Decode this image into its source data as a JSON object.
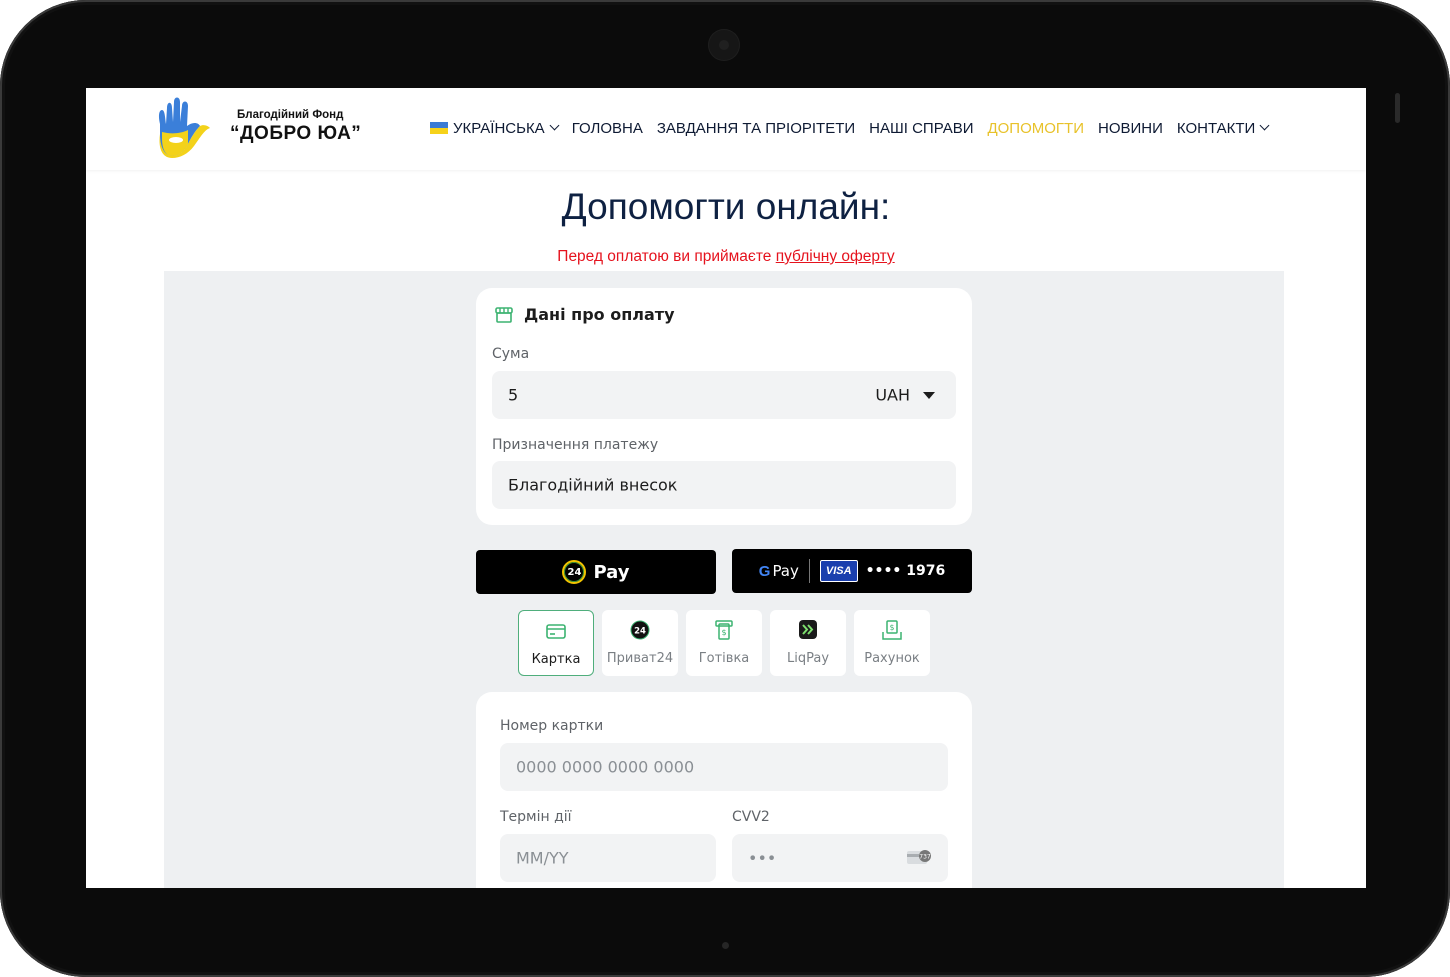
{
  "header": {
    "logo_line1": "Благодійний Фонд",
    "logo_line2": "“ДОБРО ЮА”",
    "nav": [
      {
        "label": "УКРАЇНСЬКА",
        "has_flag": true,
        "dropdown": true
      },
      {
        "label": "ГОЛОВНА"
      },
      {
        "label": "ЗАВДАННЯ ТА ПРІОРІТЕТИ"
      },
      {
        "label": "НАШІ СПРАВИ"
      },
      {
        "label": "ДОПОМОГТИ",
        "active": true
      },
      {
        "label": "НОВИНИ"
      },
      {
        "label": "КОНТАКТИ",
        "dropdown": true
      }
    ]
  },
  "page": {
    "title": "Допомогти онлайн:",
    "notice_prefix": "Перед оплатою ви приймаєте ",
    "notice_link": "публічну оферту"
  },
  "payment": {
    "section_title": "Дані про оплату",
    "amount_label": "Сума",
    "amount_value": "5",
    "currency": "UAH",
    "purpose_label": "Призначення платежу",
    "purpose_value": "Благодійний внесок"
  },
  "quick_pay": {
    "p24_badge": "24",
    "p24_label": "Pay",
    "gpay_g": "G",
    "gpay_label": "Pay",
    "card_brand": "VISA",
    "card_masked": "•••• 1976"
  },
  "methods": [
    {
      "label": "Картка",
      "icon": "card-icon",
      "active": true
    },
    {
      "label": "Приват24",
      "icon": "privat24-icon"
    },
    {
      "label": "Готівка",
      "icon": "cash-icon"
    },
    {
      "label": "LiqPay",
      "icon": "liqpay-icon"
    },
    {
      "label": "Рахунок",
      "icon": "invoice-icon"
    }
  ],
  "card_form": {
    "number_label": "Номер картки",
    "number_placeholder": "0000 0000 0000 0000",
    "expiry_label": "Термін дії",
    "expiry_placeholder": "MM/YY",
    "cvv_label": "CVV2",
    "cvv_placeholder": "•••"
  },
  "colors": {
    "nav_active": "#e8c22a",
    "notice": "#e5121d",
    "title": "#0e2142",
    "method_active_border": "#4fae7c",
    "icon_green": "#3cb371"
  }
}
